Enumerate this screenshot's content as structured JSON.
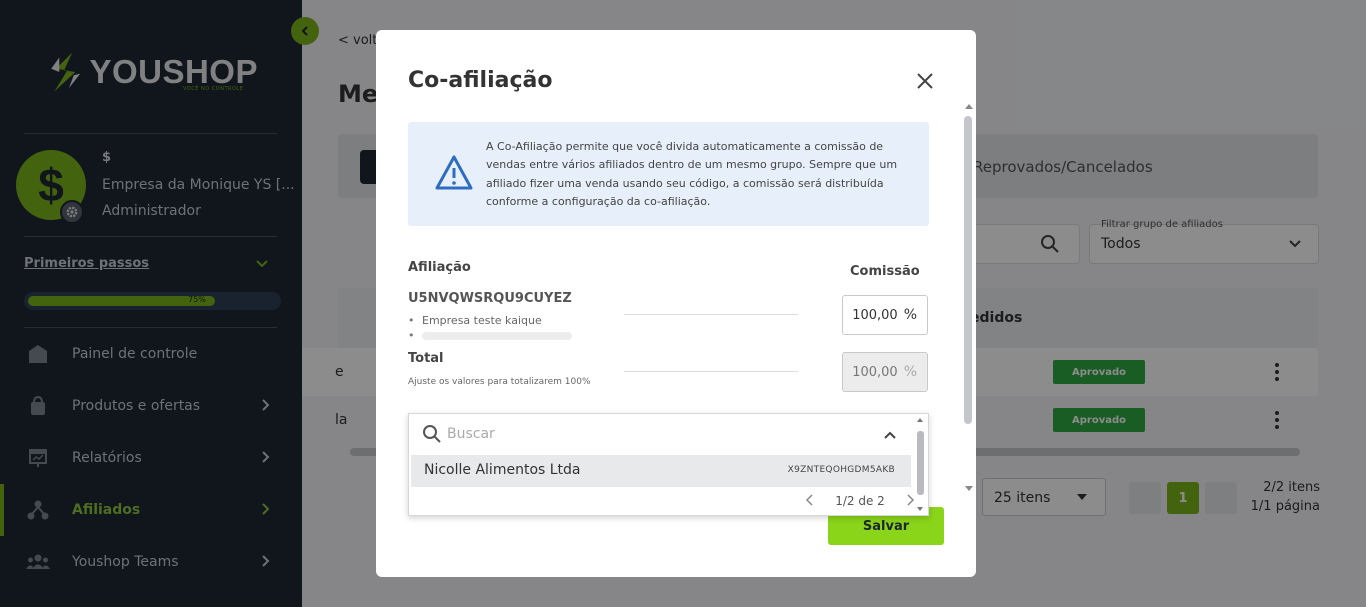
{
  "sidebar": {
    "brand": "YOUSHOP",
    "brand_tagline": "VOCÊ NO CONTROLE",
    "user": {
      "avatar_symbol": "$",
      "title": "$",
      "company": "Empresa da Monique YS [...",
      "role": "Administrador"
    },
    "first_steps": {
      "label": "Primeiros passos",
      "progress_label": "75%",
      "progress_fraction": 0.75
    },
    "nav": [
      {
        "label": "Painel de controle",
        "icon": "home-icon",
        "has_chevron": false,
        "active": false
      },
      {
        "label": "Produtos e ofertas",
        "icon": "bag-icon",
        "has_chevron": true,
        "active": false
      },
      {
        "label": "Relatórios",
        "icon": "report-icon",
        "has_chevron": true,
        "active": false
      },
      {
        "label": "Afiliados",
        "icon": "network-icon",
        "has_chevron": true,
        "active": true
      },
      {
        "label": "Youshop Teams",
        "icon": "team-icon",
        "has_chevron": true,
        "active": false
      }
    ]
  },
  "background_page": {
    "back_link": "< volta",
    "title": "Me",
    "tab_rejected": "Reprovados/Cancelados",
    "filter_label": "Filtrar grupo de afiliados",
    "filter_value": "Todos",
    "column_pedidos": "edidos",
    "rows": [
      {
        "text": "e",
        "status": "Aprovado"
      },
      {
        "text": "la",
        "status": "Aprovado"
      }
    ],
    "per_page": "25 itens",
    "current_page": "1",
    "items_count": "2/2 itens",
    "pages_count": "1/1 página"
  },
  "modal": {
    "title": "Co-afiliação",
    "info_text": "A Co-Afiliação permite que você divida automaticamente a comissão de vendas entre vários afiliados dentro de um mesmo grupo. Sempre que um afiliado fizer uma venda usando seu código, a comissão será distribuída conforme a configuração da co-afiliação.",
    "affiliation_label": "Afiliação",
    "commission_label": "Comissão",
    "affiliation_code": "U5NVQWSRQU9CUYEZ",
    "members": [
      "Empresa teste kaique"
    ],
    "commission_value": "100,00",
    "percent_symbol": "%",
    "total_label": "Total",
    "total_hint": "Ajuste os valores para totalizarem 100%",
    "total_value": "100,00",
    "save_label": "Salvar"
  },
  "dropdown": {
    "search_placeholder": "Buscar",
    "options": [
      {
        "name": "Nicolle Alimentos Ltda",
        "code": "X9ZNTEQOHGDM5AKB"
      }
    ],
    "pager": "1/2 de 2"
  },
  "colors": {
    "sidebar_bg": "#1f2733",
    "accent_green": "#7ab51d",
    "save_green": "#8ad41a",
    "badge_green": "#2eaa44",
    "info_bg": "#e7f0fa",
    "warning_icon": "#2d6cc0"
  }
}
